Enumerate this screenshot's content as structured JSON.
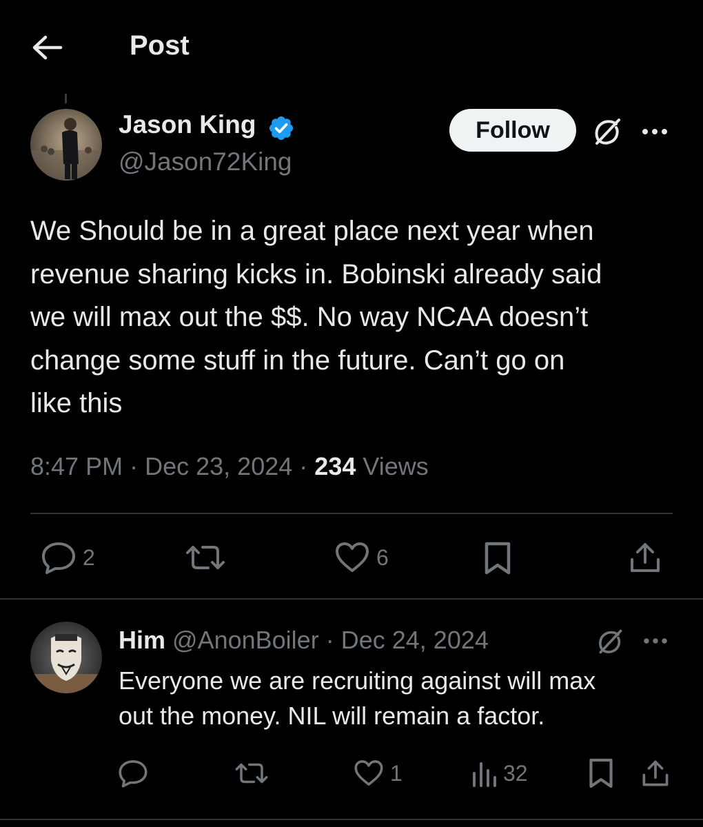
{
  "header": {
    "title": "Post"
  },
  "post": {
    "author": {
      "name": "Jason King",
      "handle": "@Jason72King"
    },
    "follow_label": "Follow",
    "text": "We Should be in a great place next year when\nrevenue sharing kicks in. Bobinski already said\nwe will max out the $$. No way NCAA doesn’t\nchange some stuff in the future. Can’t go on\nlike this",
    "time": "8:47 PM",
    "date": "Dec 23, 2024",
    "separator": "·",
    "views_count": "234",
    "views_label": "Views",
    "actions": {
      "replies": "2",
      "likes": "6"
    }
  },
  "reply": {
    "name": "Him",
    "handle": "@AnonBoiler",
    "separator": "·",
    "date": "Dec 24, 2024",
    "text": "Everyone we are recruiting against will max\nout the money. NIL will remain a factor.",
    "actions": {
      "likes": "1",
      "views": "32"
    }
  },
  "colors": {
    "background": "#000000",
    "text_primary": "#e7e9ea",
    "text_secondary": "#71767b",
    "verified": "#1d9bf0",
    "follow_bg": "#eff3f4",
    "divider": "#2f3336"
  }
}
